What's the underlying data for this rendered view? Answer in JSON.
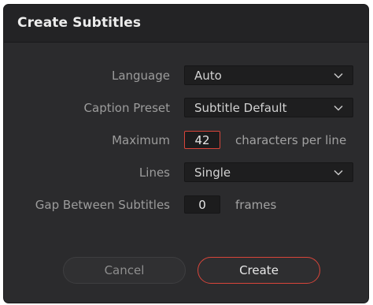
{
  "dialog": {
    "title": "Create Subtitles"
  },
  "fields": {
    "language": {
      "label": "Language",
      "value": "Auto"
    },
    "caption_preset": {
      "label": "Caption Preset",
      "value": "Subtitle Default"
    },
    "maximum": {
      "label": "Maximum",
      "value": "42",
      "suffix": "characters per line"
    },
    "lines": {
      "label": "Lines",
      "value": "Single"
    },
    "gap": {
      "label": "Gap Between Subtitles",
      "value": "0",
      "suffix": "frames"
    }
  },
  "buttons": {
    "cancel": "Cancel",
    "create": "Create"
  },
  "colors": {
    "accent": "#d8453a",
    "background": "#2b2b2d",
    "titlebar": "#232325"
  }
}
